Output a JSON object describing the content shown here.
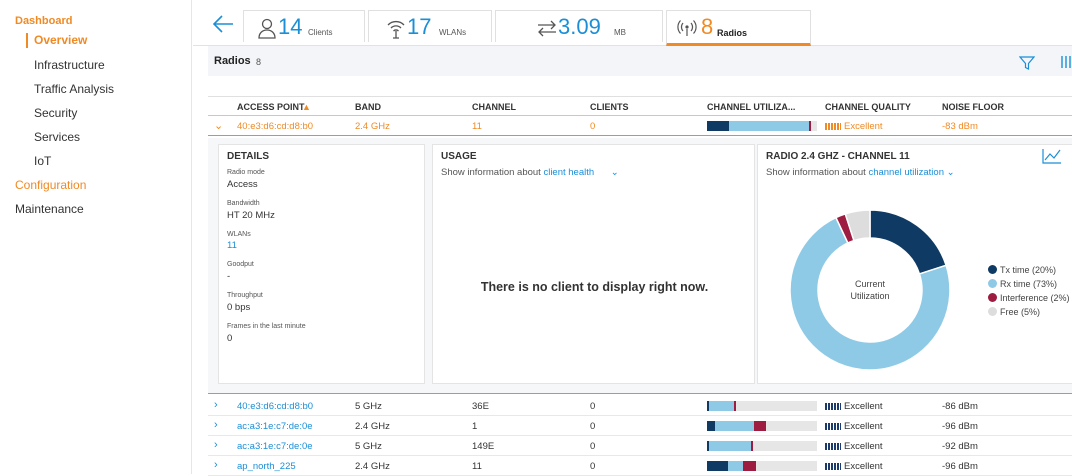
{
  "sidebar": {
    "dashboard": "Dashboard",
    "overview": "Overview",
    "items": [
      "Infrastructure",
      "Traffic Analysis",
      "Security",
      "Services",
      "IoT"
    ],
    "configuration": "Configuration",
    "maintenance": "Maintenance"
  },
  "summary": {
    "back_icon": "arrow-left-icon",
    "cards": [
      {
        "icon": "user-icon",
        "value": "14",
        "label": "Clients"
      },
      {
        "icon": "wifi-icon",
        "value": "17",
        "label": "WLANs"
      },
      {
        "icon": "transfer-icon",
        "value": "3.09",
        "label": "MB"
      },
      {
        "icon": "radio-icon",
        "value": "8",
        "label": "Radios",
        "active": true
      }
    ]
  },
  "radios_bar": {
    "title": "Radios",
    "count": "8"
  },
  "table": {
    "headers": [
      "ACCESS POINT",
      "BAND",
      "CHANNEL",
      "CLIENTS",
      "CHANNEL UTILIZA...",
      "CHANNEL QUALITY",
      "NOISE FLOOR"
    ],
    "sort_indicator": "▲",
    "selected_row": {
      "access_point": "40:e3:d6:cd:d8:b0",
      "band": "2.4 GHz",
      "channel": "11",
      "clients": "0",
      "quality": "Excellent",
      "noise": "-83 dBm"
    },
    "rows": [
      {
        "access_point": "40:e3:d6:cd:d8:b0",
        "band": "5 GHz",
        "channel": "36E",
        "clients": "0",
        "quality": "Excellent",
        "noise": "-86 dBm"
      },
      {
        "access_point": "ac:a3:1e:c7:de:0e",
        "band": "2.4 GHz",
        "channel": "1",
        "clients": "0",
        "quality": "Excellent",
        "noise": "-96 dBm"
      },
      {
        "access_point": "ac:a3:1e:c7:de:0e",
        "band": "5 GHz",
        "channel": "149E",
        "clients": "0",
        "quality": "Excellent",
        "noise": "-92 dBm"
      },
      {
        "access_point": "ap_north_225",
        "band": "2.4 GHz",
        "channel": "11",
        "clients": "0",
        "quality": "Excellent",
        "noise": "-96 dBm"
      }
    ],
    "utilization": [
      [
        0.2,
        0.73,
        0.02
      ],
      [
        0.02,
        0.23,
        0.02
      ],
      [
        0.07,
        0.35,
        0.11
      ],
      [
        0.02,
        0.38,
        0.02
      ],
      [
        0.19,
        0.14,
        0.12
      ]
    ]
  },
  "details": {
    "title": "DETAILS",
    "fields": [
      {
        "key": "Radio mode",
        "value": "Access"
      },
      {
        "key": "Bandwidth",
        "value": "HT 20 MHz"
      },
      {
        "key": "WLANs",
        "value": "11"
      },
      {
        "key": "Goodput",
        "value": "-"
      },
      {
        "key": "Throughput",
        "value": "0 bps"
      },
      {
        "key": "Frames in the last minute",
        "value": "0"
      }
    ]
  },
  "usage": {
    "title": "USAGE",
    "info_prefix": "Show information about",
    "info_link": "client health",
    "empty_message": "There is no client to display right now."
  },
  "radio_panel": {
    "title": "RADIO 2.4 GHZ - CHANNEL 11",
    "info_prefix": "Show information about",
    "info_link": "channel utilization",
    "center_label_1": "Current",
    "center_label_2": "Utilization",
    "legend": [
      "Tx time (20%)",
      "Rx time (73%)",
      "Interference (2%)",
      "Free (5%)"
    ]
  },
  "chart_data": {
    "type": "pie",
    "title": "RADIO 2.4 GHZ - CHANNEL 11",
    "categories": [
      "Tx time",
      "Rx time",
      "Interference",
      "Free"
    ],
    "values": [
      20,
      73,
      2,
      5
    ],
    "colors": [
      "#0e3a63",
      "#8ecae6",
      "#9e1c3f",
      "#dddddd"
    ]
  },
  "colors": {
    "accent": "#f08a24",
    "link": "#1a8fd8",
    "tx": "#0e3a63",
    "rx": "#8ecae6",
    "interference": "#9e1c3f",
    "free": "#dddddd"
  }
}
